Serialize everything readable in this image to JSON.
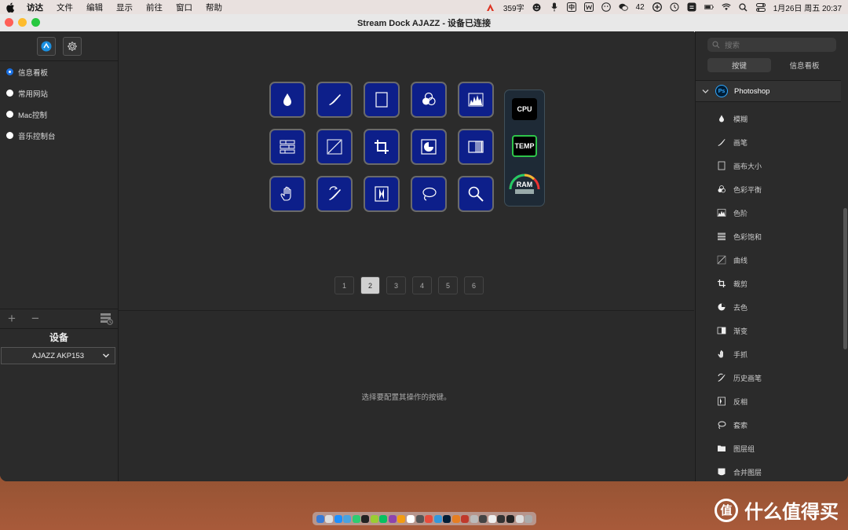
{
  "menubar": {
    "items": [
      "访达",
      "文件",
      "编辑",
      "显示",
      "前往",
      "窗口",
      "帮助"
    ],
    "word_count": "359字",
    "notification_count": "42",
    "datetime": "1月26日 周五 20:37"
  },
  "window": {
    "title": "Stream Dock AJAZZ - 设备已连接"
  },
  "left": {
    "profiles": [
      {
        "label": "信息看板",
        "selected": true
      },
      {
        "label": "常用网站",
        "selected": false
      },
      {
        "label": "Mac控制",
        "selected": false
      },
      {
        "label": "音乐控制台",
        "selected": false
      }
    ],
    "device_title": "设备",
    "device_value": "AJAZZ AKP153"
  },
  "center": {
    "keys": [
      {
        "icon": "drop-icon"
      },
      {
        "icon": "brush-icon"
      },
      {
        "icon": "canvas-icon"
      },
      {
        "icon": "color-balance-icon"
      },
      {
        "icon": "levels-icon"
      },
      {
        "icon": "hue-saturation-icon"
      },
      {
        "icon": "curves-icon"
      },
      {
        "icon": "crop-icon"
      },
      {
        "icon": "desaturate-icon"
      },
      {
        "icon": "gradient-icon"
      },
      {
        "icon": "hand-icon"
      },
      {
        "icon": "history-brush-icon"
      },
      {
        "icon": "invert-icon"
      },
      {
        "icon": "lasso-icon"
      },
      {
        "icon": "zoom-icon"
      }
    ],
    "monitor": {
      "cpu": "CPU",
      "temp": "TEMP",
      "ram": "RAM"
    },
    "pages": [
      "1",
      "2",
      "3",
      "4",
      "5",
      "6"
    ],
    "active_page": "2",
    "hint": "选择要配置其操作的按键。"
  },
  "right": {
    "search_placeholder": "搜索",
    "tabs": [
      "按键",
      "信息看板"
    ],
    "category": "Photoshop",
    "category_logo": "Ps",
    "actions": [
      {
        "label": "模糊",
        "icon": "drop-icon"
      },
      {
        "label": "画笔",
        "icon": "brush-icon"
      },
      {
        "label": "画布大小",
        "icon": "canvas-icon"
      },
      {
        "label": "色彩平衡",
        "icon": "color-balance-icon"
      },
      {
        "label": "色阶",
        "icon": "levels-icon"
      },
      {
        "label": "色彩饱和",
        "icon": "hue-saturation-icon"
      },
      {
        "label": "曲线",
        "icon": "curves-icon"
      },
      {
        "label": "裁剪",
        "icon": "crop-icon"
      },
      {
        "label": "去色",
        "icon": "desaturate-icon"
      },
      {
        "label": "渐变",
        "icon": "gradient-icon"
      },
      {
        "label": "手抓",
        "icon": "hand-icon"
      },
      {
        "label": "历史画笔",
        "icon": "history-brush-icon"
      },
      {
        "label": "反相",
        "icon": "invert-icon"
      },
      {
        "label": "套索",
        "icon": "lasso-icon"
      },
      {
        "label": "图层组",
        "icon": "folder-icon"
      },
      {
        "label": "合并图层",
        "icon": "merge-layers-icon"
      }
    ]
  },
  "watermark": {
    "text": "什么值得买",
    "logo": "值"
  },
  "colors": {
    "key_bg": "#0d1f8a",
    "accent": "#1a6fe0",
    "ps_blue": "#31a8ff"
  }
}
